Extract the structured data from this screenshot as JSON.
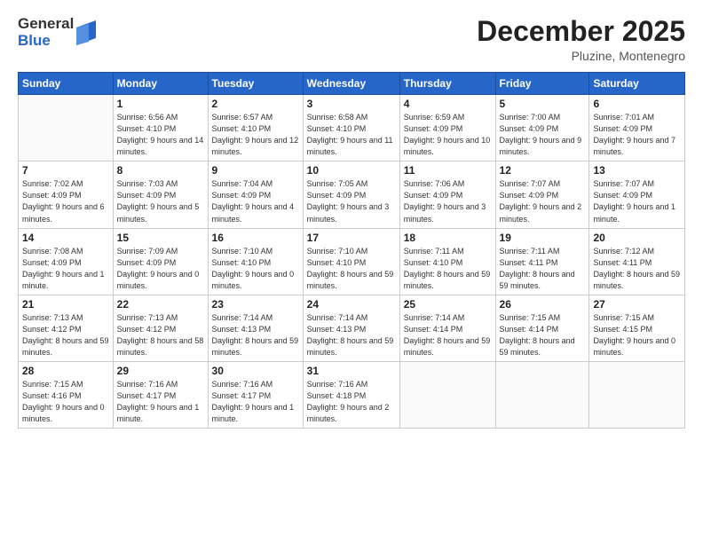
{
  "logo": {
    "general": "General",
    "blue": "Blue"
  },
  "title": "December 2025",
  "subtitle": "Pluzine, Montenegro",
  "days_of_week": [
    "Sunday",
    "Monday",
    "Tuesday",
    "Wednesday",
    "Thursday",
    "Friday",
    "Saturday"
  ],
  "weeks": [
    [
      {
        "day": "",
        "sunrise": "",
        "sunset": "",
        "daylight": ""
      },
      {
        "day": "1",
        "sunrise": "Sunrise: 6:56 AM",
        "sunset": "Sunset: 4:10 PM",
        "daylight": "Daylight: 9 hours and 14 minutes."
      },
      {
        "day": "2",
        "sunrise": "Sunrise: 6:57 AM",
        "sunset": "Sunset: 4:10 PM",
        "daylight": "Daylight: 9 hours and 12 minutes."
      },
      {
        "day": "3",
        "sunrise": "Sunrise: 6:58 AM",
        "sunset": "Sunset: 4:10 PM",
        "daylight": "Daylight: 9 hours and 11 minutes."
      },
      {
        "day": "4",
        "sunrise": "Sunrise: 6:59 AM",
        "sunset": "Sunset: 4:09 PM",
        "daylight": "Daylight: 9 hours and 10 minutes."
      },
      {
        "day": "5",
        "sunrise": "Sunrise: 7:00 AM",
        "sunset": "Sunset: 4:09 PM",
        "daylight": "Daylight: 9 hours and 9 minutes."
      },
      {
        "day": "6",
        "sunrise": "Sunrise: 7:01 AM",
        "sunset": "Sunset: 4:09 PM",
        "daylight": "Daylight: 9 hours and 7 minutes."
      }
    ],
    [
      {
        "day": "7",
        "sunrise": "Sunrise: 7:02 AM",
        "sunset": "Sunset: 4:09 PM",
        "daylight": "Daylight: 9 hours and 6 minutes."
      },
      {
        "day": "8",
        "sunrise": "Sunrise: 7:03 AM",
        "sunset": "Sunset: 4:09 PM",
        "daylight": "Daylight: 9 hours and 5 minutes."
      },
      {
        "day": "9",
        "sunrise": "Sunrise: 7:04 AM",
        "sunset": "Sunset: 4:09 PM",
        "daylight": "Daylight: 9 hours and 4 minutes."
      },
      {
        "day": "10",
        "sunrise": "Sunrise: 7:05 AM",
        "sunset": "Sunset: 4:09 PM",
        "daylight": "Daylight: 9 hours and 3 minutes."
      },
      {
        "day": "11",
        "sunrise": "Sunrise: 7:06 AM",
        "sunset": "Sunset: 4:09 PM",
        "daylight": "Daylight: 9 hours and 3 minutes."
      },
      {
        "day": "12",
        "sunrise": "Sunrise: 7:07 AM",
        "sunset": "Sunset: 4:09 PM",
        "daylight": "Daylight: 9 hours and 2 minutes."
      },
      {
        "day": "13",
        "sunrise": "Sunrise: 7:07 AM",
        "sunset": "Sunset: 4:09 PM",
        "daylight": "Daylight: 9 hours and 1 minute."
      }
    ],
    [
      {
        "day": "14",
        "sunrise": "Sunrise: 7:08 AM",
        "sunset": "Sunset: 4:09 PM",
        "daylight": "Daylight: 9 hours and 1 minute."
      },
      {
        "day": "15",
        "sunrise": "Sunrise: 7:09 AM",
        "sunset": "Sunset: 4:09 PM",
        "daylight": "Daylight: 9 hours and 0 minutes."
      },
      {
        "day": "16",
        "sunrise": "Sunrise: 7:10 AM",
        "sunset": "Sunset: 4:10 PM",
        "daylight": "Daylight: 9 hours and 0 minutes."
      },
      {
        "day": "17",
        "sunrise": "Sunrise: 7:10 AM",
        "sunset": "Sunset: 4:10 PM",
        "daylight": "Daylight: 8 hours and 59 minutes."
      },
      {
        "day": "18",
        "sunrise": "Sunrise: 7:11 AM",
        "sunset": "Sunset: 4:10 PM",
        "daylight": "Daylight: 8 hours and 59 minutes."
      },
      {
        "day": "19",
        "sunrise": "Sunrise: 7:11 AM",
        "sunset": "Sunset: 4:11 PM",
        "daylight": "Daylight: 8 hours and 59 minutes."
      },
      {
        "day": "20",
        "sunrise": "Sunrise: 7:12 AM",
        "sunset": "Sunset: 4:11 PM",
        "daylight": "Daylight: 8 hours and 59 minutes."
      }
    ],
    [
      {
        "day": "21",
        "sunrise": "Sunrise: 7:13 AM",
        "sunset": "Sunset: 4:12 PM",
        "daylight": "Daylight: 8 hours and 59 minutes."
      },
      {
        "day": "22",
        "sunrise": "Sunrise: 7:13 AM",
        "sunset": "Sunset: 4:12 PM",
        "daylight": "Daylight: 8 hours and 58 minutes."
      },
      {
        "day": "23",
        "sunrise": "Sunrise: 7:14 AM",
        "sunset": "Sunset: 4:13 PM",
        "daylight": "Daylight: 8 hours and 59 minutes."
      },
      {
        "day": "24",
        "sunrise": "Sunrise: 7:14 AM",
        "sunset": "Sunset: 4:13 PM",
        "daylight": "Daylight: 8 hours and 59 minutes."
      },
      {
        "day": "25",
        "sunrise": "Sunrise: 7:14 AM",
        "sunset": "Sunset: 4:14 PM",
        "daylight": "Daylight: 8 hours and 59 minutes."
      },
      {
        "day": "26",
        "sunrise": "Sunrise: 7:15 AM",
        "sunset": "Sunset: 4:14 PM",
        "daylight": "Daylight: 8 hours and 59 minutes."
      },
      {
        "day": "27",
        "sunrise": "Sunrise: 7:15 AM",
        "sunset": "Sunset: 4:15 PM",
        "daylight": "Daylight: 9 hours and 0 minutes."
      }
    ],
    [
      {
        "day": "28",
        "sunrise": "Sunrise: 7:15 AM",
        "sunset": "Sunset: 4:16 PM",
        "daylight": "Daylight: 9 hours and 0 minutes."
      },
      {
        "day": "29",
        "sunrise": "Sunrise: 7:16 AM",
        "sunset": "Sunset: 4:17 PM",
        "daylight": "Daylight: 9 hours and 1 minute."
      },
      {
        "day": "30",
        "sunrise": "Sunrise: 7:16 AM",
        "sunset": "Sunset: 4:17 PM",
        "daylight": "Daylight: 9 hours and 1 minute."
      },
      {
        "day": "31",
        "sunrise": "Sunrise: 7:16 AM",
        "sunset": "Sunset: 4:18 PM",
        "daylight": "Daylight: 9 hours and 2 minutes."
      },
      {
        "day": "",
        "sunrise": "",
        "sunset": "",
        "daylight": ""
      },
      {
        "day": "",
        "sunrise": "",
        "sunset": "",
        "daylight": ""
      },
      {
        "day": "",
        "sunrise": "",
        "sunset": "",
        "daylight": ""
      }
    ]
  ]
}
